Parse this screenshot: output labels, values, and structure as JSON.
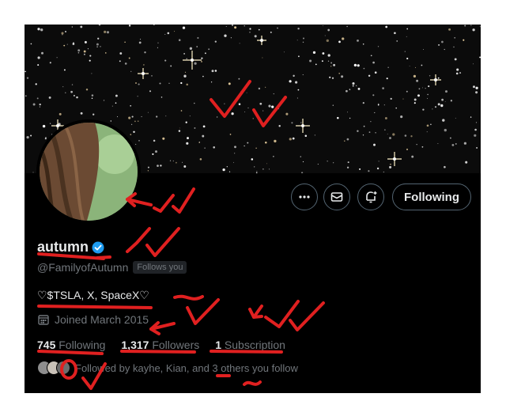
{
  "profile": {
    "display_name": "autumn",
    "handle": "@FamilyofAutumn",
    "follows_you": "Follows you",
    "bio": "♡$TSLA, X, SpaceX♡",
    "joined": "Joined March 2015"
  },
  "actions": {
    "more_icon": "more-horizontal-icon",
    "message_icon": "envelope-icon",
    "notify_icon": "bell-plus-icon",
    "following_label": "Following"
  },
  "stats": {
    "following_count": "745",
    "following_label": "Following",
    "followers_count": "1,317",
    "followers_label": "Followers",
    "subscription_count": "1",
    "subscription_label": "Subscription"
  },
  "followed_by": {
    "text": "Followed by kayhe, Kian, and 3 others you follow"
  },
  "colors": {
    "background": "#000000",
    "text_primary": "#e7e9ea",
    "text_secondary": "#71767b",
    "verified_blue": "#1d9bf0",
    "annotation_red": "#e02020"
  }
}
